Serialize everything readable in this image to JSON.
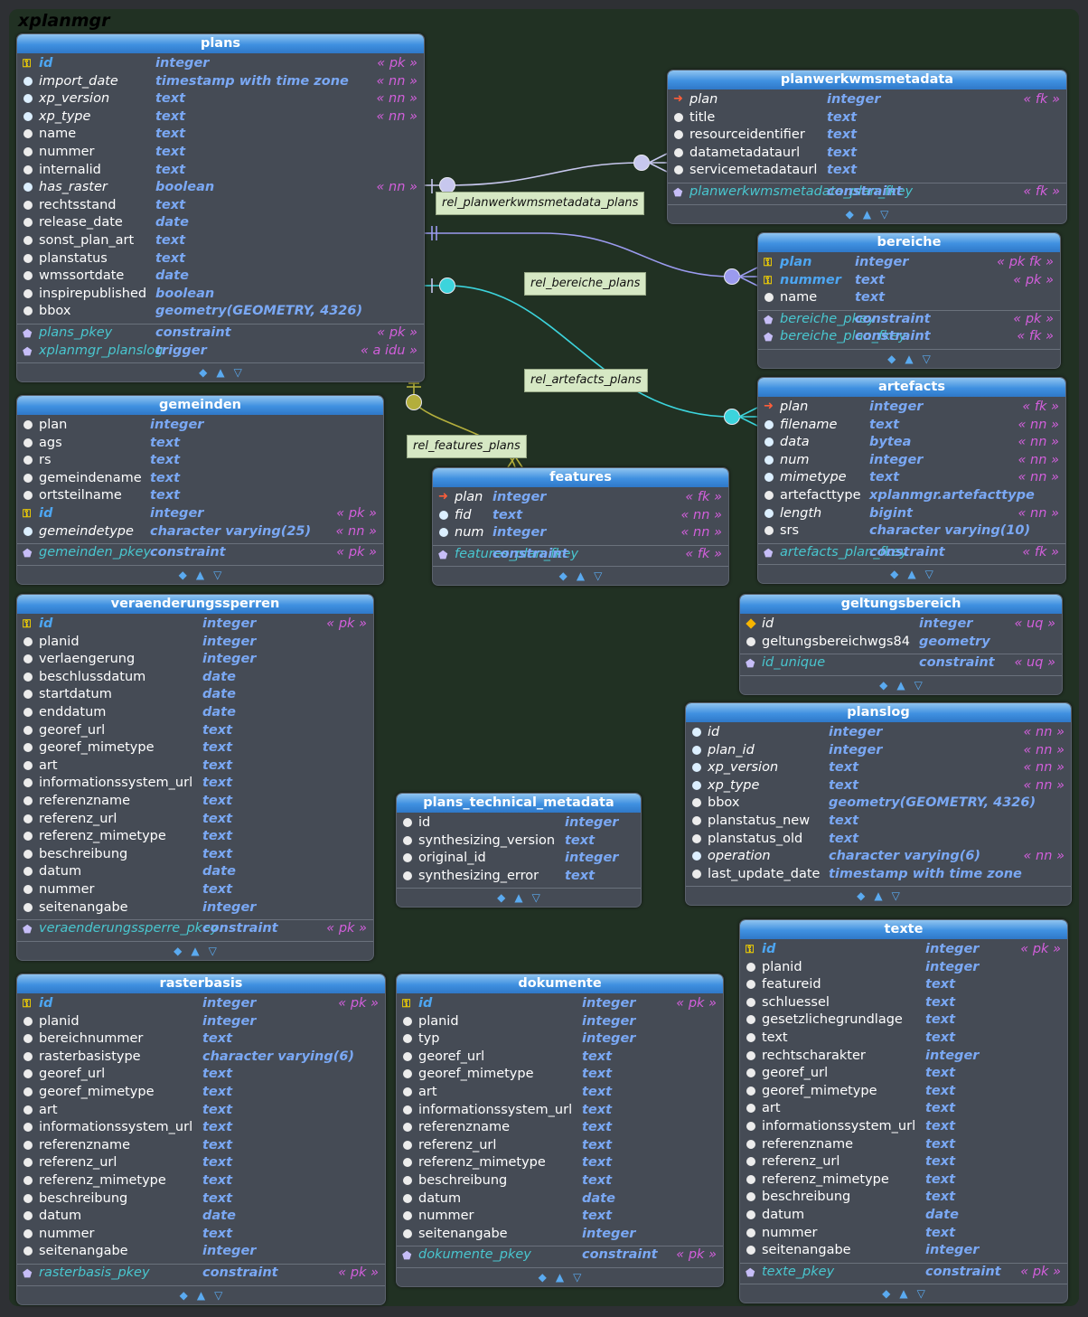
{
  "schema": "xplanmgr",
  "tables": [
    {
      "key": "plans",
      "name": "plans",
      "columns": [
        {
          "kind": "pk",
          "name": "id",
          "type": "integer",
          "ann": "« pk »"
        },
        {
          "kind": "nn",
          "name": "import_date",
          "type": "timestamp with time zone",
          "ann": "« nn »"
        },
        {
          "kind": "nn",
          "name": "xp_version",
          "type": "text",
          "ann": "« nn »"
        },
        {
          "kind": "nn",
          "name": "xp_type",
          "type": "text",
          "ann": "« nn »"
        },
        {
          "kind": "col",
          "name": "name",
          "type": "text",
          "ann": ""
        },
        {
          "kind": "col",
          "name": "nummer",
          "type": "text",
          "ann": ""
        },
        {
          "kind": "col",
          "name": "internalid",
          "type": "text",
          "ann": ""
        },
        {
          "kind": "nn",
          "name": "has_raster",
          "type": "boolean",
          "ann": "« nn »"
        },
        {
          "kind": "col",
          "name": "rechtsstand",
          "type": "text",
          "ann": ""
        },
        {
          "kind": "col",
          "name": "release_date",
          "type": "date",
          "ann": ""
        },
        {
          "kind": "col",
          "name": "sonst_plan_art",
          "type": "text",
          "ann": ""
        },
        {
          "kind": "col",
          "name": "planstatus",
          "type": "text",
          "ann": ""
        },
        {
          "kind": "col",
          "name": "wmssortdate",
          "type": "date",
          "ann": ""
        },
        {
          "kind": "col",
          "name": "inspirepublished",
          "type": "boolean",
          "ann": ""
        },
        {
          "kind": "col",
          "name": "bbox",
          "type": "geometry(GEOMETRY, 4326)",
          "ann": ""
        }
      ],
      "constraints": [
        {
          "name": "plans_pkey",
          "type": "constraint",
          "ann": "« pk »"
        },
        {
          "name": "xplanmgr_planslog",
          "type": "trigger",
          "ann": "« a idu »"
        }
      ]
    },
    {
      "key": "pwms",
      "name": "planwerkwmsmetadata",
      "columns": [
        {
          "kind": "fk",
          "name": "plan",
          "type": "integer",
          "ann": "« fk »"
        },
        {
          "kind": "col",
          "name": "title",
          "type": "text",
          "ann": ""
        },
        {
          "kind": "col",
          "name": "resourceidentifier",
          "type": "text",
          "ann": ""
        },
        {
          "kind": "col",
          "name": "datametadataurl",
          "type": "text",
          "ann": ""
        },
        {
          "kind": "col",
          "name": "servicemetadataurl",
          "type": "text",
          "ann": ""
        }
      ],
      "constraints": [
        {
          "name": "planwerkwmsmetadata_plan_fkey",
          "type": "constraint",
          "ann": "« fk »"
        }
      ]
    },
    {
      "key": "bereiche",
      "name": "bereiche",
      "columns": [
        {
          "kind": "pk",
          "name": "plan",
          "type": "integer",
          "ann": "« pk fk »"
        },
        {
          "kind": "pk",
          "name": "nummer",
          "type": "text",
          "ann": "« pk »"
        },
        {
          "kind": "col",
          "name": "name",
          "type": "text",
          "ann": ""
        }
      ],
      "constraints": [
        {
          "name": "bereiche_pkey",
          "type": "constraint",
          "ann": "« pk »"
        },
        {
          "name": "bereiche_plan_fkey",
          "type": "constraint",
          "ann": "« fk »"
        }
      ]
    },
    {
      "key": "artefacts",
      "name": "artefacts",
      "columns": [
        {
          "kind": "fk",
          "name": "plan",
          "type": "integer",
          "ann": "« fk »"
        },
        {
          "kind": "nn",
          "name": "filename",
          "type": "text",
          "ann": "« nn »"
        },
        {
          "kind": "nn",
          "name": "data",
          "type": "bytea",
          "ann": "« nn »"
        },
        {
          "kind": "nn",
          "name": "num",
          "type": "integer",
          "ann": "« nn »"
        },
        {
          "kind": "nn",
          "name": "mimetype",
          "type": "text",
          "ann": "« nn »"
        },
        {
          "kind": "col",
          "name": "artefacttype",
          "type": "xplanmgr.artefacttype",
          "ann": ""
        },
        {
          "kind": "nn",
          "name": "length",
          "type": "bigint",
          "ann": "« nn »"
        },
        {
          "kind": "col",
          "name": "srs",
          "type": "character varying(10)",
          "ann": ""
        }
      ],
      "constraints": [
        {
          "name": "artefacts_plan_fkey",
          "type": "constraint",
          "ann": "« fk »"
        }
      ]
    },
    {
      "key": "gemeinden",
      "name": "gemeinden",
      "columns": [
        {
          "kind": "col",
          "name": "plan",
          "type": "integer",
          "ann": ""
        },
        {
          "kind": "col",
          "name": "ags",
          "type": "text",
          "ann": ""
        },
        {
          "kind": "col",
          "name": "rs",
          "type": "text",
          "ann": ""
        },
        {
          "kind": "col",
          "name": "gemeindename",
          "type": "text",
          "ann": ""
        },
        {
          "kind": "col",
          "name": "ortsteilname",
          "type": "text",
          "ann": ""
        },
        {
          "kind": "pk",
          "name": "id",
          "type": "integer",
          "ann": "« pk »"
        },
        {
          "kind": "nn",
          "name": "gemeindetype",
          "type": "character varying(25)",
          "ann": "« nn »"
        }
      ],
      "constraints": [
        {
          "name": "gemeinden_pkey",
          "type": "constraint",
          "ann": "« pk »"
        }
      ]
    },
    {
      "key": "features",
      "name": "features",
      "columns": [
        {
          "kind": "fk",
          "name": "plan",
          "type": "integer",
          "ann": "« fk »"
        },
        {
          "kind": "nn",
          "name": "fid",
          "type": "text",
          "ann": "« nn »"
        },
        {
          "kind": "nn",
          "name": "num",
          "type": "integer",
          "ann": "« nn »"
        }
      ],
      "constraints": [
        {
          "name": "features_plan_fkey",
          "type": "constraint",
          "ann": "« fk »"
        }
      ]
    },
    {
      "key": "veraend",
      "name": "veraenderungssperren",
      "columns": [
        {
          "kind": "pk",
          "name": "id",
          "type": "integer",
          "ann": "« pk »"
        },
        {
          "kind": "col",
          "name": "planid",
          "type": "integer",
          "ann": ""
        },
        {
          "kind": "col",
          "name": "verlaengerung",
          "type": "integer",
          "ann": ""
        },
        {
          "kind": "col",
          "name": "beschlussdatum",
          "type": "date",
          "ann": ""
        },
        {
          "kind": "col",
          "name": "startdatum",
          "type": "date",
          "ann": ""
        },
        {
          "kind": "col",
          "name": "enddatum",
          "type": "date",
          "ann": ""
        },
        {
          "kind": "col",
          "name": "georef_url",
          "type": "text",
          "ann": ""
        },
        {
          "kind": "col",
          "name": "georef_mimetype",
          "type": "text",
          "ann": ""
        },
        {
          "kind": "col",
          "name": "art",
          "type": "text",
          "ann": ""
        },
        {
          "kind": "col",
          "name": "informationssystem_url",
          "type": "text",
          "ann": ""
        },
        {
          "kind": "col",
          "name": "referenzname",
          "type": "text",
          "ann": ""
        },
        {
          "kind": "col",
          "name": "referenz_url",
          "type": "text",
          "ann": ""
        },
        {
          "kind": "col",
          "name": "referenz_mimetype",
          "type": "text",
          "ann": ""
        },
        {
          "kind": "col",
          "name": "beschreibung",
          "type": "text",
          "ann": ""
        },
        {
          "kind": "col",
          "name": "datum",
          "type": "date",
          "ann": ""
        },
        {
          "kind": "col",
          "name": "nummer",
          "type": "text",
          "ann": ""
        },
        {
          "kind": "col",
          "name": "seitenangabe",
          "type": "integer",
          "ann": ""
        }
      ],
      "constraints": [
        {
          "name": "veraenderungssperre_pkey",
          "type": "constraint",
          "ann": "« pk »"
        }
      ]
    },
    {
      "key": "geltung",
      "name": "geltungsbereich",
      "columns": [
        {
          "kind": "uq",
          "name": "id",
          "type": "integer",
          "ann": "« uq »"
        },
        {
          "kind": "col",
          "name": "geltungsbereichwgs84",
          "type": "geometry",
          "ann": ""
        }
      ],
      "constraints": [
        {
          "name": "id_unique",
          "type": "constraint",
          "ann": "« uq »"
        }
      ]
    },
    {
      "key": "planslog",
      "name": "planslog",
      "columns": [
        {
          "kind": "nn",
          "name": "id",
          "type": "integer",
          "ann": "« nn »"
        },
        {
          "kind": "nn",
          "name": "plan_id",
          "type": "integer",
          "ann": "« nn »"
        },
        {
          "kind": "nn",
          "name": "xp_version",
          "type": "text",
          "ann": "« nn »"
        },
        {
          "kind": "nn",
          "name": "xp_type",
          "type": "text",
          "ann": "« nn »"
        },
        {
          "kind": "col",
          "name": "bbox",
          "type": "geometry(GEOMETRY, 4326)",
          "ann": ""
        },
        {
          "kind": "col",
          "name": "planstatus_new",
          "type": "text",
          "ann": ""
        },
        {
          "kind": "col",
          "name": "planstatus_old",
          "type": "text",
          "ann": ""
        },
        {
          "kind": "nn",
          "name": "operation",
          "type": "character varying(6)",
          "ann": "« nn »"
        },
        {
          "kind": "col",
          "name": "last_update_date",
          "type": "timestamp with time zone",
          "ann": ""
        }
      ],
      "constraints": []
    },
    {
      "key": "ptm",
      "name": "plans_technical_metadata",
      "columns": [
        {
          "kind": "col",
          "name": "id",
          "type": "integer",
          "ann": ""
        },
        {
          "kind": "col",
          "name": "synthesizing_version",
          "type": "text",
          "ann": ""
        },
        {
          "kind": "col",
          "name": "original_id",
          "type": "integer",
          "ann": ""
        },
        {
          "kind": "col",
          "name": "synthesizing_error",
          "type": "text",
          "ann": ""
        }
      ],
      "constraints": []
    },
    {
      "key": "texte",
      "name": "texte",
      "columns": [
        {
          "kind": "pk",
          "name": "id",
          "type": "integer",
          "ann": "« pk »"
        },
        {
          "kind": "col",
          "name": "planid",
          "type": "integer",
          "ann": ""
        },
        {
          "kind": "col",
          "name": "featureid",
          "type": "text",
          "ann": ""
        },
        {
          "kind": "col",
          "name": "schluessel",
          "type": "text",
          "ann": ""
        },
        {
          "kind": "col",
          "name": "gesetzlichegrundlage",
          "type": "text",
          "ann": ""
        },
        {
          "kind": "col",
          "name": "text",
          "type": "text",
          "ann": ""
        },
        {
          "kind": "col",
          "name": "rechtscharakter",
          "type": "integer",
          "ann": ""
        },
        {
          "kind": "col",
          "name": "georef_url",
          "type": "text",
          "ann": ""
        },
        {
          "kind": "col",
          "name": "georef_mimetype",
          "type": "text",
          "ann": ""
        },
        {
          "kind": "col",
          "name": "art",
          "type": "text",
          "ann": ""
        },
        {
          "kind": "col",
          "name": "informationssystem_url",
          "type": "text",
          "ann": ""
        },
        {
          "kind": "col",
          "name": "referenzname",
          "type": "text",
          "ann": ""
        },
        {
          "kind": "col",
          "name": "referenz_url",
          "type": "text",
          "ann": ""
        },
        {
          "kind": "col",
          "name": "referenz_mimetype",
          "type": "text",
          "ann": ""
        },
        {
          "kind": "col",
          "name": "beschreibung",
          "type": "text",
          "ann": ""
        },
        {
          "kind": "col",
          "name": "datum",
          "type": "date",
          "ann": ""
        },
        {
          "kind": "col",
          "name": "nummer",
          "type": "text",
          "ann": ""
        },
        {
          "kind": "col",
          "name": "seitenangabe",
          "type": "integer",
          "ann": ""
        }
      ],
      "constraints": [
        {
          "name": "texte_pkey",
          "type": "constraint",
          "ann": "« pk »"
        }
      ]
    },
    {
      "key": "raster",
      "name": "rasterbasis",
      "columns": [
        {
          "kind": "pk",
          "name": "id",
          "type": "integer",
          "ann": "« pk »"
        },
        {
          "kind": "col",
          "name": "planid",
          "type": "integer",
          "ann": ""
        },
        {
          "kind": "col",
          "name": "bereichnummer",
          "type": "text",
          "ann": ""
        },
        {
          "kind": "col",
          "name": "rasterbasistype",
          "type": "character varying(6)",
          "ann": ""
        },
        {
          "kind": "col",
          "name": "georef_url",
          "type": "text",
          "ann": ""
        },
        {
          "kind": "col",
          "name": "georef_mimetype",
          "type": "text",
          "ann": ""
        },
        {
          "kind": "col",
          "name": "art",
          "type": "text",
          "ann": ""
        },
        {
          "kind": "col",
          "name": "informationssystem_url",
          "type": "text",
          "ann": ""
        },
        {
          "kind": "col",
          "name": "referenzname",
          "type": "text",
          "ann": ""
        },
        {
          "kind": "col",
          "name": "referenz_url",
          "type": "text",
          "ann": ""
        },
        {
          "kind": "col",
          "name": "referenz_mimetype",
          "type": "text",
          "ann": ""
        },
        {
          "kind": "col",
          "name": "beschreibung",
          "type": "text",
          "ann": ""
        },
        {
          "kind": "col",
          "name": "datum",
          "type": "date",
          "ann": ""
        },
        {
          "kind": "col",
          "name": "nummer",
          "type": "text",
          "ann": ""
        },
        {
          "kind": "col",
          "name": "seitenangabe",
          "type": "integer",
          "ann": ""
        }
      ],
      "constraints": [
        {
          "name": "rasterbasis_pkey",
          "type": "constraint",
          "ann": "« pk »"
        }
      ]
    },
    {
      "key": "dokumente",
      "name": "dokumente",
      "columns": [
        {
          "kind": "pk",
          "name": "id",
          "type": "integer",
          "ann": "« pk »"
        },
        {
          "kind": "col",
          "name": "planid",
          "type": "integer",
          "ann": ""
        },
        {
          "kind": "col",
          "name": "typ",
          "type": "integer",
          "ann": ""
        },
        {
          "kind": "col",
          "name": "georef_url",
          "type": "text",
          "ann": ""
        },
        {
          "kind": "col",
          "name": "georef_mimetype",
          "type": "text",
          "ann": ""
        },
        {
          "kind": "col",
          "name": "art",
          "type": "text",
          "ann": ""
        },
        {
          "kind": "col",
          "name": "informationssystem_url",
          "type": "text",
          "ann": ""
        },
        {
          "kind": "col",
          "name": "referenzname",
          "type": "text",
          "ann": ""
        },
        {
          "kind": "col",
          "name": "referenz_url",
          "type": "text",
          "ann": ""
        },
        {
          "kind": "col",
          "name": "referenz_mimetype",
          "type": "text",
          "ann": ""
        },
        {
          "kind": "col",
          "name": "beschreibung",
          "type": "text",
          "ann": ""
        },
        {
          "kind": "col",
          "name": "datum",
          "type": "date",
          "ann": ""
        },
        {
          "kind": "col",
          "name": "nummer",
          "type": "text",
          "ann": ""
        },
        {
          "kind": "col",
          "name": "seitenangabe",
          "type": "integer",
          "ann": ""
        }
      ],
      "constraints": [
        {
          "name": "dokumente_pkey",
          "type": "constraint",
          "ann": "« pk »"
        }
      ]
    }
  ],
  "relations": [
    {
      "key": "r1",
      "label": "rel_planwerkwmsmetadata_plans",
      "color": "#c7c7ee"
    },
    {
      "key": "r2",
      "label": "rel_bereiche_plans",
      "color": "#9b9bef"
    },
    {
      "key": "r3",
      "label": "rel_artefacts_plans",
      "color": "#3cd4dc"
    },
    {
      "key": "r4",
      "label": "rel_features_plans",
      "color": "#b3ae3c"
    }
  ],
  "footer_icons": [
    "◆",
    "▲",
    "▽"
  ],
  "colors": {
    "background": "#213123",
    "table": "#454b55",
    "header": "#3f90e0",
    "type": "#7aa8f4",
    "annotation": "#d25fdb",
    "constraint": "#49c6cf"
  }
}
